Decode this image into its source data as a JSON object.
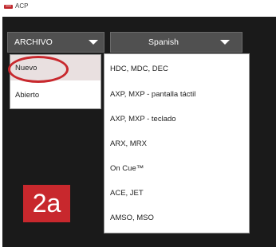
{
  "window": {
    "title": "ACP",
    "icon": "acp-logo-icon"
  },
  "toolbar": {
    "file_menu_label": "ARCHIVO",
    "language_selected": "Spanish",
    "chevron_icon": "chevron-down-icon"
  },
  "file_menu": {
    "items": [
      {
        "label": "Nuevo"
      },
      {
        "label": "Abierto"
      }
    ]
  },
  "submenu": {
    "items": [
      {
        "label": "HDC, MDC, DEC"
      },
      {
        "label": "AXP, MXP - pantalla táctil"
      },
      {
        "label": "AXP, MXP - teclado"
      },
      {
        "label": "ARX, MRX"
      },
      {
        "label": "On Cue™"
      },
      {
        "label": "ACE, JET"
      },
      {
        "label": "AMSO, MSO"
      }
    ]
  },
  "annotation": {
    "step_label": "2a",
    "color": "#c8282d"
  }
}
